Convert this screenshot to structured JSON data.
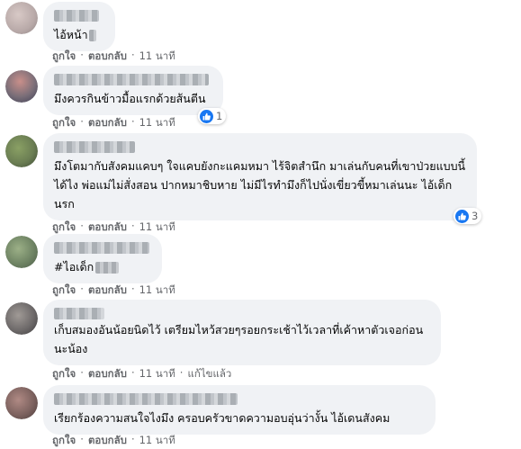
{
  "labels": {
    "like": "ถูกใจ",
    "reply": "ตอบกลับ",
    "dot": "·"
  },
  "comments": [
    {
      "text": "ไอ้หน้า",
      "time": "11 นาที",
      "reactions": ""
    },
    {
      "text": "มึงควรกินข้าวมื้อแรกด้วยส้นตีน",
      "time": "11 นาที",
      "reactions": "1"
    },
    {
      "text": "มึงโตมากับสังคมแคบๆ ใจแคบยังกะแคมหมา ไร้จิตสำนึก มาเล่นกับคนที่เขาป่วยแบบนี้ได้ไง พ่อแม่ไม่สั่งสอน ปากหมาชิบหาย ไม่มีไรทำมึงก็ไปนั่งเขี่ยวขี้หมาเล่นนะ ไอ้เด็กนรก",
      "time": "11 นาที",
      "reactions": "3"
    },
    {
      "text": "#ไอเด็ก",
      "time": "11 นาที",
      "reactions": ""
    },
    {
      "text": "เก็บสมองอันน้อยนิดไว้ เตรียมไหว้สวยๆรอยกระเช้าไว้เวลาที่เค้าหาตัวเจอก่อนนะน้อง",
      "time": "11 นาที",
      "edited": "แก้ไขแล้ว",
      "reactions": ""
    },
    {
      "text": "เรียกร้องความสนใจไงมึง ครอบครัวขาดความอบอุ่นว่างั้น ไอ้เดนสังคม",
      "time": "11 นาที",
      "reactions": ""
    }
  ],
  "colors": {
    "like_blue": "#1877f2",
    "bubble_bg": "#f0f2f5",
    "meta_gray": "#65676b"
  }
}
